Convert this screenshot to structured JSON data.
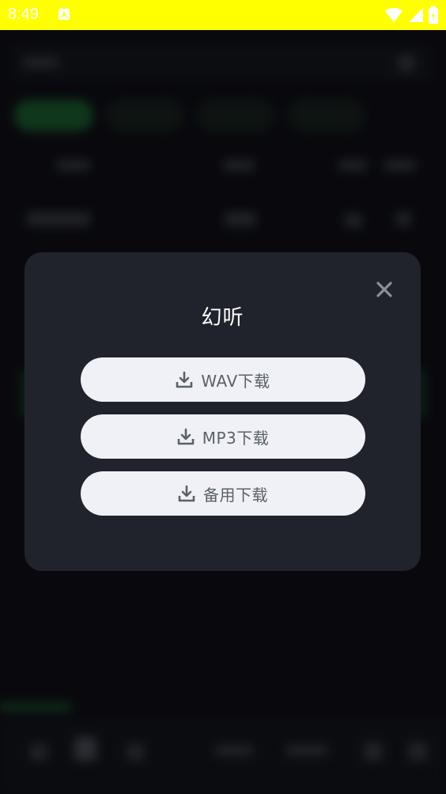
{
  "status_bar": {
    "time": "8:49",
    "icons": [
      "app-notification-icon",
      "wifi-icon",
      "cell-signal-icon",
      "battery-icon"
    ],
    "background": "#ffff00"
  },
  "dialog": {
    "title": "幻听",
    "close_glyph": "✕",
    "buttons": [
      {
        "label": "WAV下载",
        "icon": "download-icon"
      },
      {
        "label": "MP3下载",
        "icon": "download-icon"
      },
      {
        "label": "备用下载",
        "icon": "download-icon"
      }
    ],
    "colors": {
      "background": "#20232c",
      "button_bg": "#eff1f6",
      "button_text": "#5b6169",
      "close": "#8a8f98"
    }
  }
}
